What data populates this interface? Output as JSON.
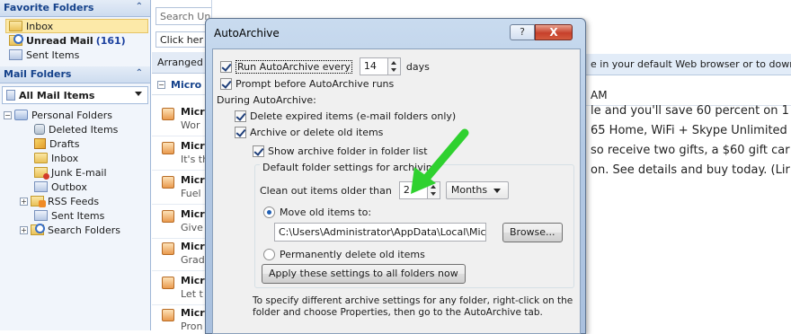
{
  "nav": {
    "favorites_header": "Favorite Folders",
    "favorites": [
      {
        "label": "Inbox",
        "count": ""
      },
      {
        "label": "Unread Mail",
        "count": "(161)"
      },
      {
        "label": "Sent Items",
        "count": ""
      }
    ],
    "mail_header": "Mail Folders",
    "all_mail_items": "All Mail Items",
    "personal_folders": "Personal Folders",
    "tree": [
      {
        "label": "Deleted Items"
      },
      {
        "label": "Drafts"
      },
      {
        "label": "Inbox"
      },
      {
        "label": "Junk E-mail"
      },
      {
        "label": "Outbox"
      },
      {
        "label": "RSS Feeds"
      },
      {
        "label": "Sent Items"
      },
      {
        "label": "Search Folders"
      }
    ]
  },
  "list": {
    "search_placeholder": "Search Un",
    "click_here": "Click her",
    "arranged": "Arranged",
    "group_label": "Micro",
    "messages": [
      {
        "from": "Micr",
        "preview": "Wor"
      },
      {
        "from": "Micr",
        "preview": "It's th"
      },
      {
        "from": "Micr",
        "preview": "Fuel"
      },
      {
        "from": "Micr",
        "preview": "Give"
      },
      {
        "from": "Micr",
        "preview": "Grad"
      },
      {
        "from": "Micr",
        "preview": "Let t"
      },
      {
        "from": "Micr",
        "preview": "Pron"
      }
    ]
  },
  "reading": {
    "info_bar": "e in your default Web browser or to down",
    "time": "AM",
    "body": [
      "le and you'll save 60 percent on 1",
      "65 Home, WiFi + Skype Unlimited",
      "so receive two gifts, a $60 gift car",
      "on. See details and buy today. (Lir"
    ]
  },
  "dialog": {
    "title": "AutoArchive",
    "help_label": "?",
    "close_label": "X",
    "run_every_label": "Run AutoArchive every",
    "run_every_value": "14",
    "days_label": "days",
    "prompt_label": "Prompt before AutoArchive runs",
    "during_label": "During AutoArchive:",
    "delete_expired_label": "Delete expired items (e-mail folders only)",
    "archive_delete_label": "Archive or delete old items",
    "show_folder_label": "Show archive folder in folder list",
    "default_settings_label": "Default folder settings for archiving",
    "clean_out_label": "Clean out items older than",
    "clean_out_value": "2",
    "clean_out_unit": "Months",
    "move_label": "Move old items to:",
    "move_path": "C:\\Users\\Administrator\\AppData\\Local\\Microsc",
    "browse_label": "Browse...",
    "perm_delete_label": "Permanently delete old items",
    "apply_all_label": "Apply these settings to all folders now",
    "footer_text": "To specify different archive settings for any folder, right-click on the folder and choose Properties, then go to the AutoArchive tab."
  },
  "colors": {
    "accent_green": "#2fd12f",
    "nav_header_text": "#15428b",
    "unread_count": "#1a3f9e"
  }
}
